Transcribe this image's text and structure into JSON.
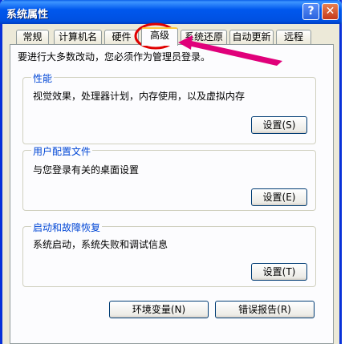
{
  "window": {
    "title": "系统属性"
  },
  "titlebar": {
    "help_glyph": "?",
    "close_glyph": "✕"
  },
  "tabs": [
    {
      "label": "常规"
    },
    {
      "label": "计算机名"
    },
    {
      "label": "硬件"
    },
    {
      "label": "高级",
      "active": true
    },
    {
      "label": "系统还原"
    },
    {
      "label": "自动更新"
    },
    {
      "label": "远程"
    }
  ],
  "panel": {
    "info": "要进行大多数改动，您必须作为管理员登录。",
    "performance": {
      "legend": "性能",
      "description": "视觉效果，处理器计划，内存使用，以及虚拟内存",
      "button": "设置(S)"
    },
    "user_profiles": {
      "legend": "用户配置文件",
      "description": "与您登录有关的桌面设置",
      "button": "设置(E)"
    },
    "startup_recovery": {
      "legend": "启动和故障恢复",
      "description": "系统启动，系统失败和调试信息",
      "button": "设置(T)"
    },
    "env_button": "环境变量(N)",
    "error_report_button": "错误报告(R)"
  },
  "annotation_color": "#e0007a",
  "circle_color": "#e00000"
}
